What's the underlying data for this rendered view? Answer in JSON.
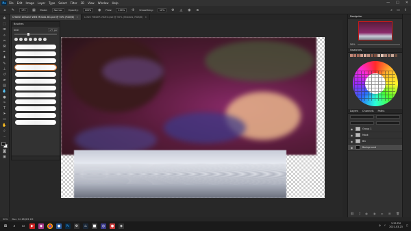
{
  "menubar": {
    "logo": "Ps",
    "items": [
      "File",
      "Edit",
      "Image",
      "Layer",
      "Type",
      "Select",
      "Filter",
      "3D",
      "View",
      "Window",
      "Help"
    ],
    "window_controls": [
      "—",
      "□",
      "✕"
    ]
  },
  "optbar": {
    "mode_label": "Mode:",
    "mode_value": "Normal",
    "opacity_label": "Opacity:",
    "opacity_value": "100%",
    "flow_label": "Flow:",
    "flow_value": "100%",
    "smoothing_label": "Smoothing:",
    "smoothing_value": "10%",
    "brush_size": "175"
  },
  "tabs": [
    {
      "label": "CHAISE DEBACE WEB MODAL BG.psd @ 50% (RGB/8)",
      "active": true
    },
    {
      "label": "LOGO FINDER VIDEO.psd @ 50% (Shadow, RGB/8)",
      "active": false
    }
  ],
  "brush_panel": {
    "title": "Brushes",
    "size_label": "Size:",
    "size_value": "175 px"
  },
  "right_dock": {
    "navigator_title": "Navigator",
    "zoom_value": "50%",
    "swatches_title": "Swatches",
    "layers_tabs": [
      "Layers",
      "Channels",
      "Paths"
    ],
    "layers": [
      {
        "name": "Group 1",
        "type": "folder",
        "active": false
      },
      {
        "name": "Mask",
        "type": "folder",
        "active": false
      },
      {
        "name": "BG",
        "type": "folder",
        "active": false
      },
      {
        "name": "Background",
        "type": "layer",
        "active": true
      }
    ]
  },
  "statusbar": {
    "zoom": "50%",
    "doc": "Doc: 6.18M/63.1M"
  },
  "taskbar": {
    "time": "2:55 PM",
    "date": "2021-03-23"
  },
  "colors": {
    "accent": "#31a8ff",
    "selection": "#e8833a"
  }
}
